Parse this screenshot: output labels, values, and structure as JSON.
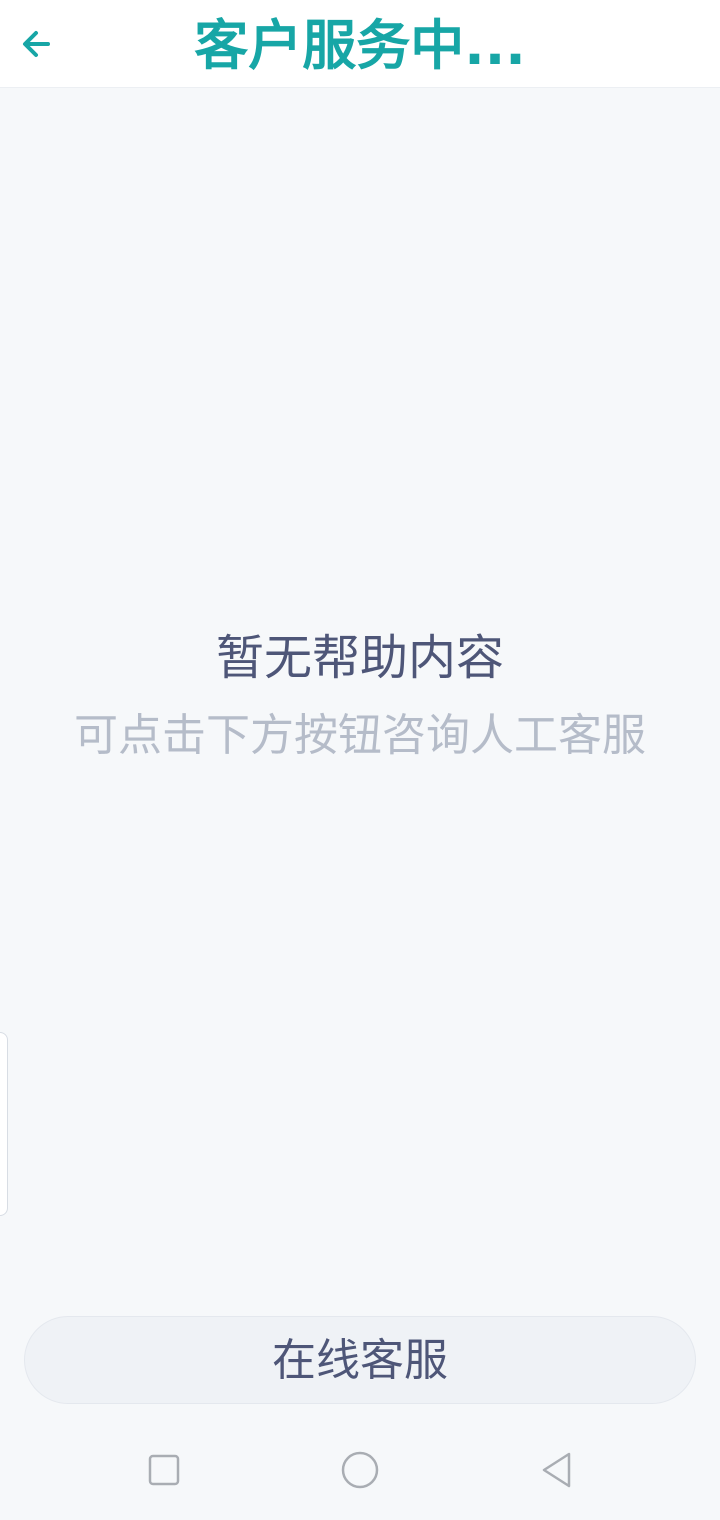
{
  "header": {
    "title": "客户服务中...",
    "back_icon": "arrow-left-icon"
  },
  "empty_state": {
    "title": "暂无帮助内容",
    "subtitle": "可点击下方按钮咨询人工客服"
  },
  "actions": {
    "online_service_label": "在线客服"
  },
  "navbar": {
    "recent_icon": "square-icon",
    "home_icon": "circle-icon",
    "back_icon": "triangle-back-icon"
  },
  "colors": {
    "accent": "#17a6a6",
    "primary_text": "#4e5678",
    "secondary_text": "#b5bcc9",
    "background": "#f6f8fa"
  }
}
